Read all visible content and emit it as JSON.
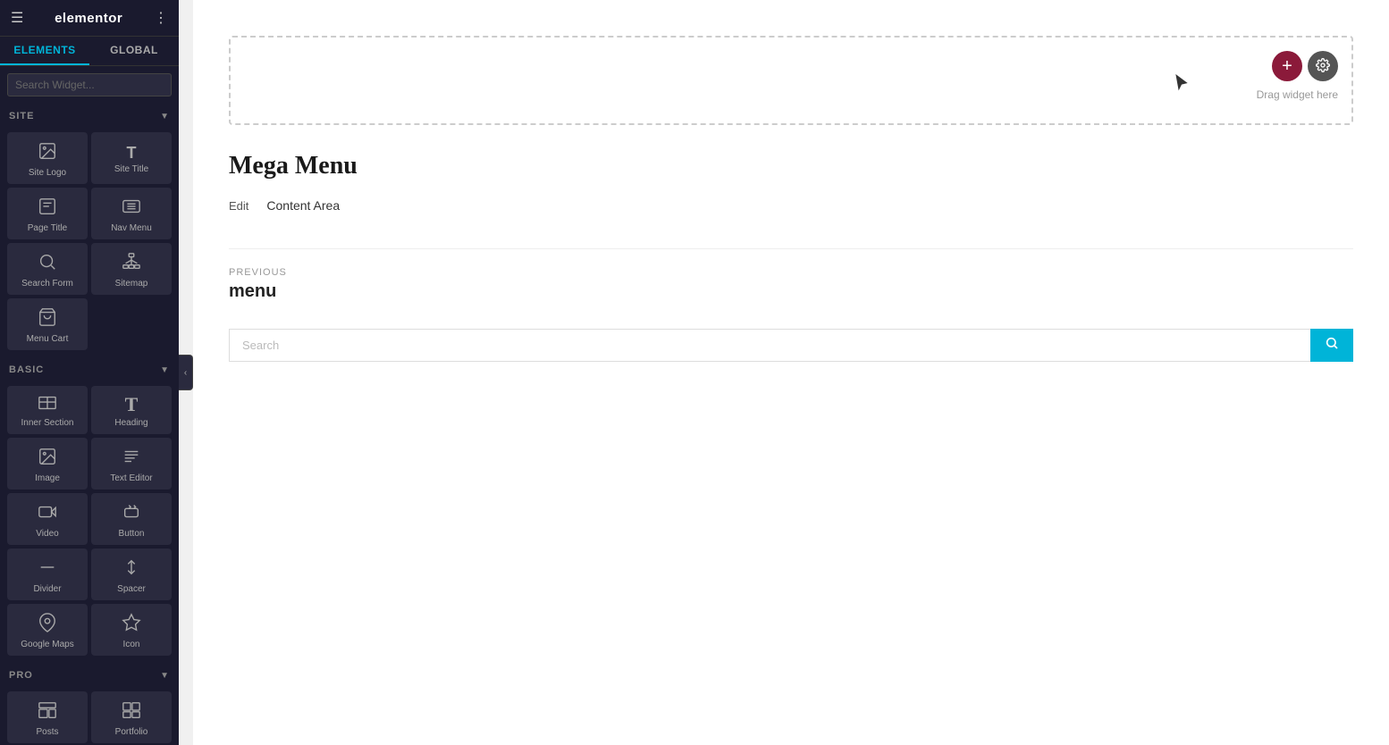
{
  "app": {
    "title": "elementor",
    "logo": "e"
  },
  "sidebar": {
    "tabs": [
      {
        "id": "elements",
        "label": "ELEMENTS",
        "active": true
      },
      {
        "id": "global",
        "label": "GLOBAL",
        "active": false
      }
    ],
    "search": {
      "placeholder": "Search Widget..."
    },
    "sections": {
      "site": {
        "label": "SITE",
        "widgets": [
          {
            "id": "site-logo",
            "label": "Site Logo",
            "icon": "🖼"
          },
          {
            "id": "site-title",
            "label": "Site Title",
            "icon": "T"
          },
          {
            "id": "page-title",
            "label": "Page Title",
            "icon": "📄"
          },
          {
            "id": "nav-menu",
            "label": "Nav Menu",
            "icon": "☰"
          },
          {
            "id": "search-form",
            "label": "Search Form",
            "icon": "🔍"
          },
          {
            "id": "sitemap",
            "label": "Sitemap",
            "icon": "⊞"
          },
          {
            "id": "menu-cart",
            "label": "Menu Cart",
            "icon": "🛒"
          }
        ]
      },
      "basic": {
        "label": "BASIC",
        "widgets": [
          {
            "id": "inner-section",
            "label": "Inner Section",
            "icon": "⊟"
          },
          {
            "id": "heading",
            "label": "Heading",
            "icon": "T"
          },
          {
            "id": "image",
            "label": "Image",
            "icon": "🖼"
          },
          {
            "id": "text-editor",
            "label": "Text Editor",
            "icon": "≡"
          },
          {
            "id": "video",
            "label": "Video",
            "icon": "▶"
          },
          {
            "id": "button",
            "label": "Button",
            "icon": "⬜"
          },
          {
            "id": "divider",
            "label": "Divider",
            "icon": "—"
          },
          {
            "id": "spacer",
            "label": "Spacer",
            "icon": "↕"
          },
          {
            "id": "google-maps",
            "label": "Google Maps",
            "icon": "🗺"
          },
          {
            "id": "icon",
            "label": "Icon",
            "icon": "☆"
          }
        ]
      },
      "pro": {
        "label": "PRO",
        "widgets": [
          {
            "id": "posts",
            "label": "Posts",
            "icon": "⊟"
          },
          {
            "id": "portfolio",
            "label": "Portfolio",
            "icon": "⊞"
          }
        ]
      }
    }
  },
  "canvas": {
    "drag_hint": "Drag widget here",
    "add_button_label": "+",
    "mega_menu_title": "Mega Menu",
    "edit_label": "Edit",
    "content_area_label": "Content Area",
    "nav": {
      "previous_label": "PREVIOUS",
      "previous_link": "menu"
    },
    "search": {
      "placeholder": "Search",
      "button_icon": "🔍"
    }
  }
}
